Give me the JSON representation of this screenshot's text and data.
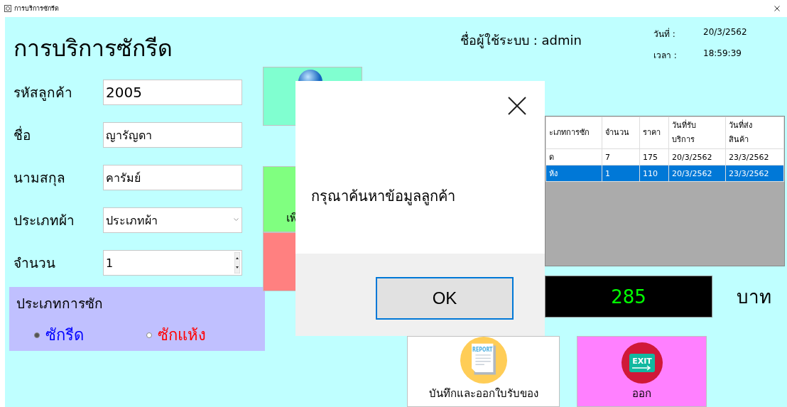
{
  "window": {
    "title": "การบริการซักรีด"
  },
  "heading": "การบริการซักรีด",
  "user": {
    "label": "ชื่อผู้ใช้ระบบ :",
    "value": "admin"
  },
  "date": {
    "label": "วันที่ :",
    "value": "20/3/2562"
  },
  "time": {
    "label": "เวลา :",
    "value": "18:59:39"
  },
  "fields": [
    {
      "kind": "text",
      "label": "รหัสลูกค้า",
      "value": "2005"
    },
    {
      "kind": "text",
      "label": "ชื่อ",
      "value": "ญารัญดา"
    },
    {
      "kind": "text",
      "label": "นามสกุล",
      "value": "คารัมย์"
    },
    {
      "kind": "select",
      "label": "ประเภทผ้า",
      "value": "ประเภทผ้า"
    },
    {
      "kind": "spin",
      "label": "จำนวน",
      "value": "1"
    }
  ],
  "wash_type": {
    "title": "ประเภทการซัก",
    "options": [
      {
        "label": "ซักรีด",
        "selected": true,
        "color": "#0000ff"
      },
      {
        "label": "ซักแห้ง",
        "selected": false,
        "color": "#ff0000"
      }
    ]
  },
  "side_buttons": [
    {
      "kind": "search"
    },
    {
      "kind": "add",
      "label": "เพิ"
    },
    {
      "kind": "delete"
    }
  ],
  "table": {
    "columns": [
      "ะเภทการซัก",
      "จำนวน",
      "ราคา",
      "วันที่รับ บริการ",
      "วันที่ส่ง สินค้า"
    ],
    "rows": [
      {
        "cells": [
          "ด",
          "7",
          "175",
          "20/3/2562",
          "23/3/2562"
        ],
        "selected": false
      },
      {
        "cells": [
          "ห้ง",
          "1",
          "110",
          "20/3/2562",
          "23/3/2562"
        ],
        "selected": true
      }
    ]
  },
  "total": {
    "value": "285",
    "unit": "บาท"
  },
  "bottom_buttons": [
    {
      "kind": "report",
      "label": "บันทึกและออกใบรับของ",
      "icon_text": "REPORT"
    },
    {
      "kind": "exit",
      "label": "ออก",
      "icon_text": "EXIT"
    }
  ],
  "dialog": {
    "message": "กรุณาค้นหาข้อมูลลูกค้า",
    "button": "OK"
  }
}
